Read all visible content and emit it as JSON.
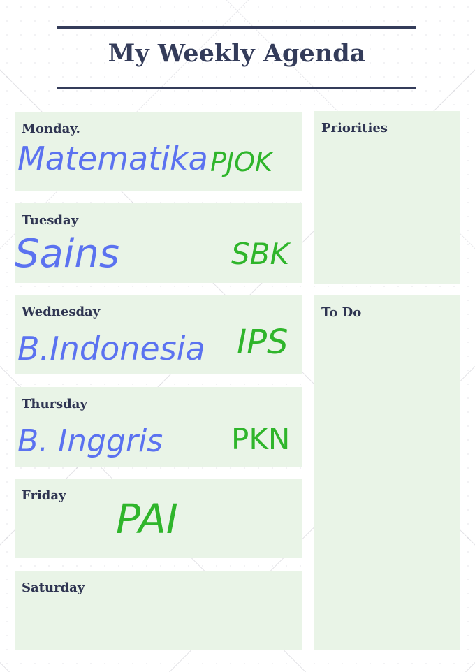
{
  "header": {
    "title": "My Weekly Agenda"
  },
  "colors": {
    "navy": "#343c5a",
    "card_bg": "#e9f4e7",
    "subject_blue": "#5b72f0",
    "subject_green": "#2fb52b"
  },
  "days": [
    {
      "label": "Monday.",
      "subjects": [
        "Matematika",
        "PJOK"
      ]
    },
    {
      "label": "Tuesday",
      "subjects": [
        "Sains",
        "SBK"
      ]
    },
    {
      "label": "Wednesday",
      "subjects": [
        "B.Indonesia",
        "IPS"
      ]
    },
    {
      "label": "Thursday",
      "subjects": [
        "B. Inggris",
        "PKN"
      ]
    },
    {
      "label": "Friday",
      "subjects": [
        "PAI"
      ]
    },
    {
      "label": "Saturday",
      "subjects": []
    }
  ],
  "panels": {
    "priorities": {
      "label": "Priorities"
    },
    "todo": {
      "label": "To Do"
    }
  }
}
